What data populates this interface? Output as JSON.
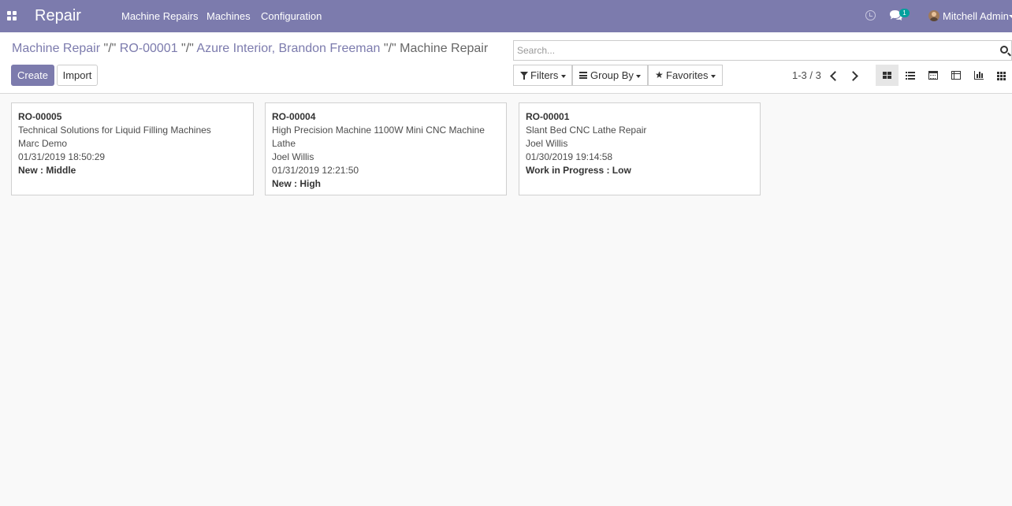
{
  "navbar": {
    "brand": "Repair",
    "menu": [
      "Machine Repairs",
      "Machines",
      "Configuration"
    ],
    "chat_count": "1",
    "user_name": "Mitchell Admin"
  },
  "breadcrumb": {
    "first": "Machine Repair",
    "sep1": " \"/\" ",
    "second": "RO-00001",
    "sep2": " \"/\" ",
    "third": "Azure Interior, Brandon Freeman",
    "sep3": " \"/\" ",
    "current": "Machine Repair"
  },
  "actions": {
    "create": "Create",
    "import": "Import"
  },
  "search": {
    "placeholder": "Search...",
    "value": ""
  },
  "search_options": {
    "filters": "Filters",
    "group_by": "Group By",
    "favorites": "Favorites"
  },
  "pager": {
    "value": "1-3 / 3"
  },
  "views": [
    "kanban",
    "list",
    "calendar",
    "pivot",
    "graph",
    "grid"
  ],
  "active_view": "kanban",
  "colors": {
    "navbar": "#7c7bad",
    "primary": "#7c7bad"
  },
  "cards": [
    {
      "ref": "RO-00005",
      "name": "Technical Solutions for Liquid Filling Machines",
      "customer": "Marc Demo",
      "date": "01/31/2019 18:50:29",
      "status": "New : Middle"
    },
    {
      "ref": "RO-00004",
      "name": "High Precision Machine 1100W Mini CNC Machine Lathe",
      "customer": "Joel Willis",
      "date": "01/31/2019 12:21:50",
      "status": "New : High"
    },
    {
      "ref": "RO-00001",
      "name": "Slant Bed CNC Lathe Repair",
      "customer": "Joel Willis",
      "date": "01/30/2019 19:14:58",
      "status": "Work in Progress : Low"
    }
  ]
}
